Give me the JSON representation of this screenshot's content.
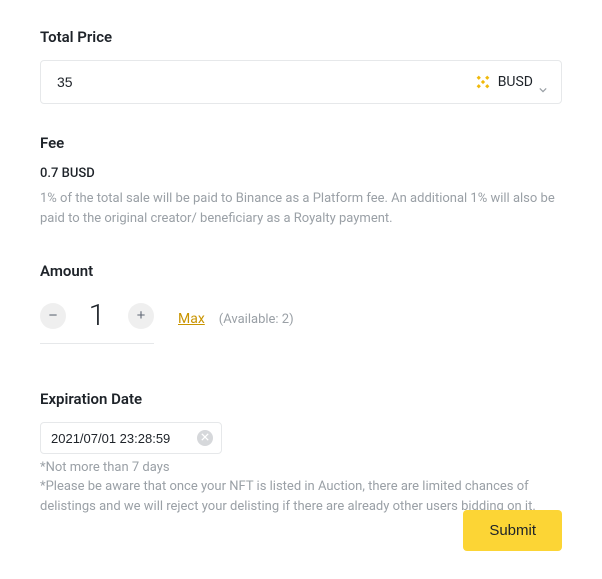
{
  "totalPrice": {
    "label": "Total Price",
    "value": "35",
    "currency": "BUSD"
  },
  "fee": {
    "label": "Fee",
    "value": "0.7 BUSD",
    "description": "1% of the total sale will be paid to Binance as a Platform fee. An additional 1% will also be paid to the original creator/ beneficiary as a Royalty payment."
  },
  "amount": {
    "label": "Amount",
    "value": "1",
    "maxLabel": "Max",
    "availableText": "(Available: 2)",
    "available": 2
  },
  "expiration": {
    "label": "Expiration Date",
    "value": "2021/07/01 23:28:59",
    "note1": "*Not more than 7 days",
    "note2": "*Please be aware that once your NFT is listed in Auction, there are limited chances of delistings and we will reject your delisting if there are already other users bidding on it."
  },
  "submitLabel": "Submit",
  "colors": {
    "accent": "#fcd535",
    "secondaryText": "#9aa0a6",
    "link": "#c99400"
  }
}
